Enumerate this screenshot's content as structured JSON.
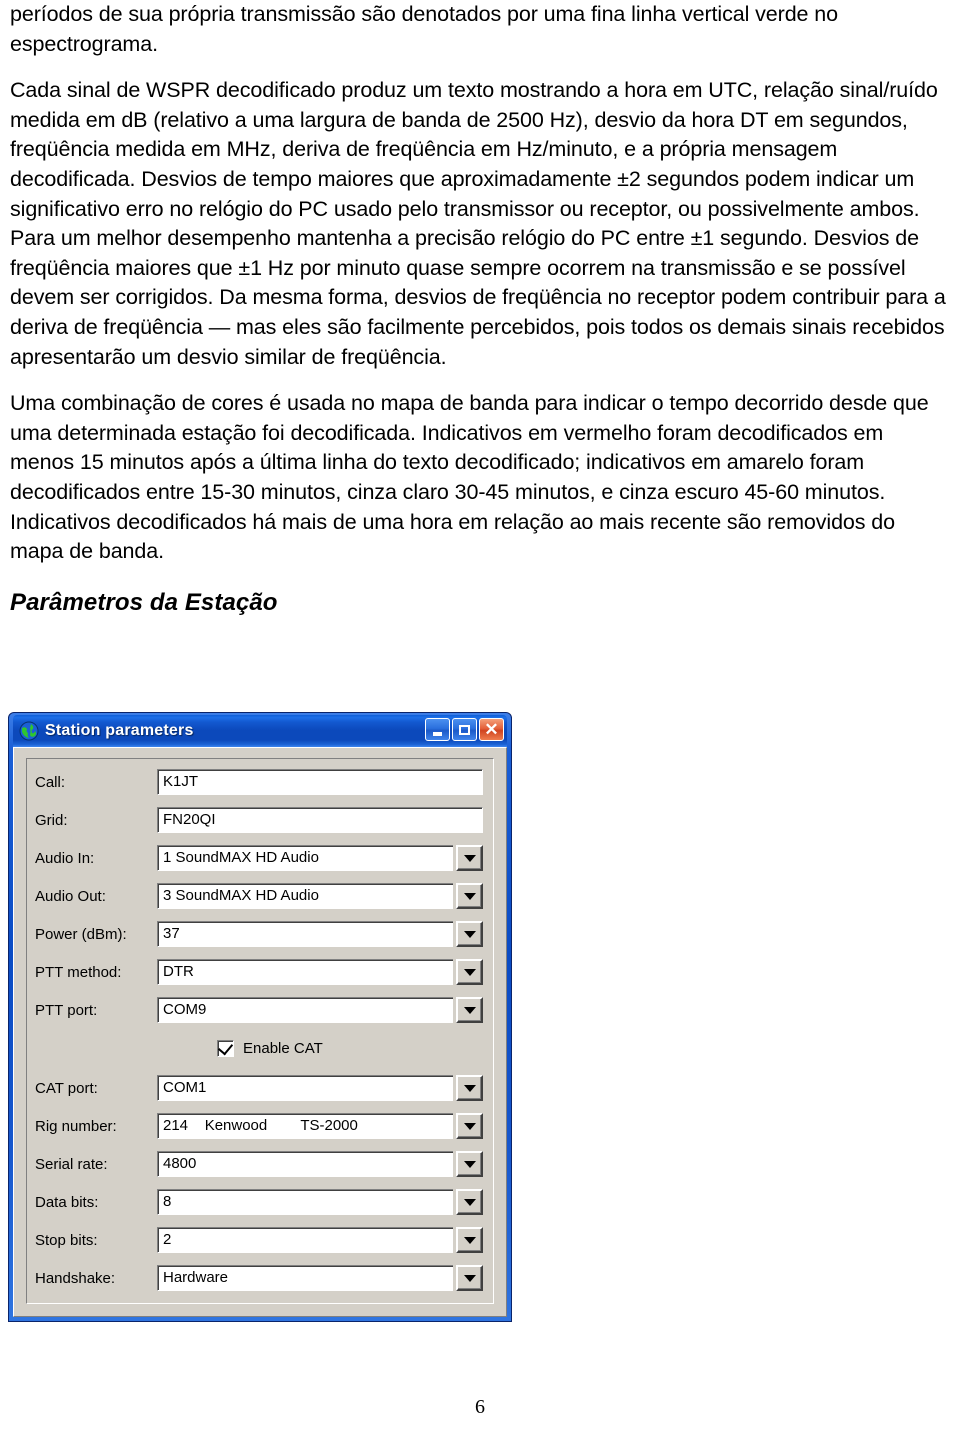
{
  "document": {
    "paragraphs": [
      "períodos de sua própria transmissão são denotados por uma fina linha vertical verde no espectrograma.",
      "Cada sinal de WSPR decodificado produz um texto mostrando a hora em UTC, relação sinal/ruído medida em dB (relativo a uma largura de banda de 2500 Hz), desvio da hora  DT em segundos, freqüência medida em MHz, deriva de freqüência em Hz/minuto, e a própria mensagem decodificada. Desvios de tempo maiores que aproximadamente ±2 segundos podem indicar um significativo erro no relógio do PC usado pelo transmissor ou receptor, ou possivelmente ambos. Para um melhor desempenho mantenha a precisão relógio do PC entre ±1 segundo.  Desvios de freqüência maiores que ±1 Hz por minuto quase sempre ocorrem na transmissão e se possível devem ser corrigidos.  Da mesma forma, desvios de freqüência no receptor podem contribuir para a deriva de freqüência — mas eles são facilmente percebidos, pois todos os demais sinais recebidos apresentarão um desvio similar de freqüência.",
      "Uma combinação de cores é usada no mapa de banda para indicar o tempo decorrido desde que uma determinada estação foi decodificada. Indicativos em vermelho foram decodificados em menos 15 minutos após a última linha do texto decodificado; indicativos em amarelo foram decodificados entre 15-30 minutos, cinza claro 30-45 minutos, e cinza escuro 45-60 minutos. Indicativos decodificados há mais de uma hora em relação ao mais recente são removidos do mapa de banda."
    ],
    "heading": "Parâmetros da Estação",
    "page_number": "6"
  },
  "dialog": {
    "title": "Station parameters",
    "icon": "globe-icon",
    "titlebar_buttons": {
      "minimize": "minimize-button",
      "maximize": "maximize-button",
      "close": "close-button"
    },
    "colors": {
      "titlebar": "#0a4bc4",
      "close_button": "#d04420",
      "client": "#d4d0c8"
    },
    "fields": [
      {
        "label": "Call:",
        "value": "K1JT",
        "type": "text"
      },
      {
        "label": "Grid:",
        "value": "FN20QI",
        "type": "text"
      },
      {
        "label": "Audio In:",
        "value": "1 SoundMAX HD Audio",
        "type": "combo"
      },
      {
        "label": "Audio Out:",
        "value": "3 SoundMAX HD Audio",
        "type": "combo"
      },
      {
        "label": "Power (dBm):",
        "value": "37",
        "type": "combo"
      },
      {
        "label": "PTT method:",
        "value": "DTR",
        "type": "combo"
      },
      {
        "label": "PTT port:",
        "value": "COM9",
        "type": "combo"
      }
    ],
    "checkbox": {
      "label": "Enable CAT",
      "checked": true
    },
    "fields2": [
      {
        "label": "CAT port:",
        "value": "COM1",
        "type": "combo"
      },
      {
        "label": "Rig number:",
        "value": "214    Kenwood        TS-2000",
        "type": "combo"
      },
      {
        "label": "Serial rate:",
        "value": "4800",
        "type": "combo"
      },
      {
        "label": "Data bits:",
        "value": "8",
        "type": "combo"
      },
      {
        "label": "Stop bits:",
        "value": "2",
        "type": "combo"
      },
      {
        "label": "Handshake:",
        "value": "Hardware",
        "type": "combo"
      }
    ]
  }
}
